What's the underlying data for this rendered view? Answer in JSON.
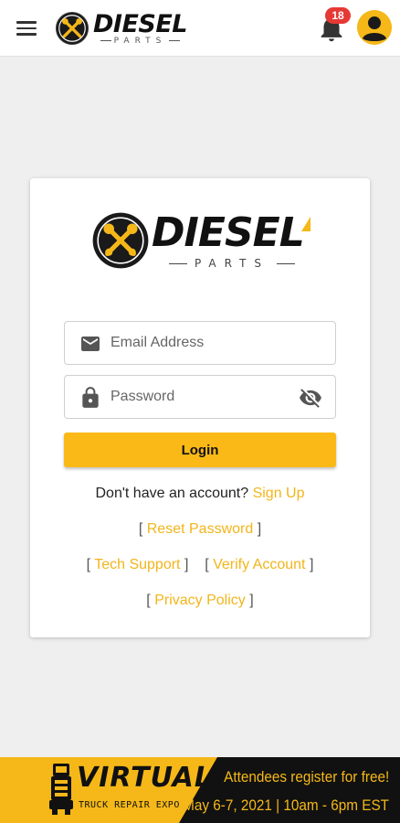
{
  "header": {
    "logo_word": "DIESEL",
    "logo_sub": "PARTS",
    "notification_count": "18"
  },
  "login": {
    "logo_word": "DIESEL",
    "logo_sub": "PARTS",
    "email_placeholder": "Email Address",
    "password_placeholder": "Password",
    "login_label": "Login",
    "no_account_text": "Don't have an account?",
    "sign_up_label": "Sign Up",
    "reset_password_label": "Reset Password",
    "tech_support_label": "Tech Support",
    "verify_account_label": "Verify Account",
    "privacy_policy_label": "Privacy Policy",
    "bracket_open": "[",
    "bracket_close": "]"
  },
  "banner": {
    "title": "VIRTUAL",
    "subtitle": "TRUCK REPAIR EXPO",
    "line1": "Attendees register for free!",
    "line2": "May 6-7, 2021 | 10am - 6pm EST"
  },
  "colors": {
    "accent": "#fbb917",
    "badge": "#e53935",
    "banner_bg": "#111111"
  },
  "icons": [
    "menu-icon",
    "diesel-logo-icon",
    "bell-icon",
    "account-icon",
    "email-icon",
    "lock-icon",
    "visibility-off-icon",
    "truck-icon"
  ]
}
